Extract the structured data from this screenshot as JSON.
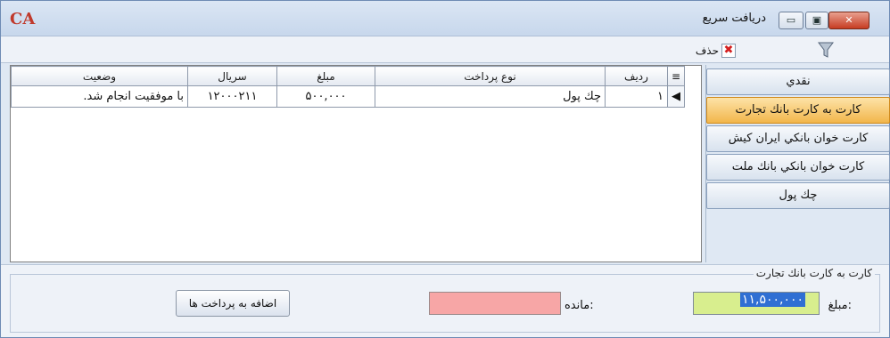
{
  "window": {
    "title": "دريافت سريع",
    "logo_text": "CA",
    "minimize_symbol": "▭",
    "maximize_symbol": "▣",
    "close_symbol": "✕"
  },
  "toolbar": {
    "delete_label": "حذف",
    "filter_icon": "filter-icon",
    "delete_icon": "delete-icon"
  },
  "grid": {
    "columns": [
      "وضعيت",
      "سريال",
      "مبلغ",
      "نوع پرداخت",
      "رديف"
    ],
    "rows": [
      {
        "status": "با موفقيت انجام شد.",
        "serial": "۱۲۰۰۰۲۱۱",
        "amount": "۵۰۰,۰۰۰",
        "payment_type": "چك پول",
        "row_num": "۱"
      }
    ]
  },
  "payment_methods": [
    {
      "label": "نقدي",
      "selected": false
    },
    {
      "label": "كارت به كارت بانك تجارت",
      "selected": true
    },
    {
      "label": "كارت خوان بانكي ايران كيش",
      "selected": false
    },
    {
      "label": "كارت خوان بانكي بانك ملت",
      "selected": false
    },
    {
      "label": "چك پول",
      "selected": false
    }
  ],
  "payment_form": {
    "group_title": "كارت به كارت بانك تجارت",
    "amount_label": "مبلغ:",
    "amount_value": "۱۱,۵۰۰,۰۰۰",
    "remaining_label": "مانده:",
    "remaining_value": "",
    "add_button_label": "اضافه به پرداخت ها"
  },
  "colors": {
    "selected_button": "#f2b64b",
    "amount_field": "#d8ee8e",
    "remaining_field": "#f7a6a6",
    "close_button": "#c63c22"
  }
}
